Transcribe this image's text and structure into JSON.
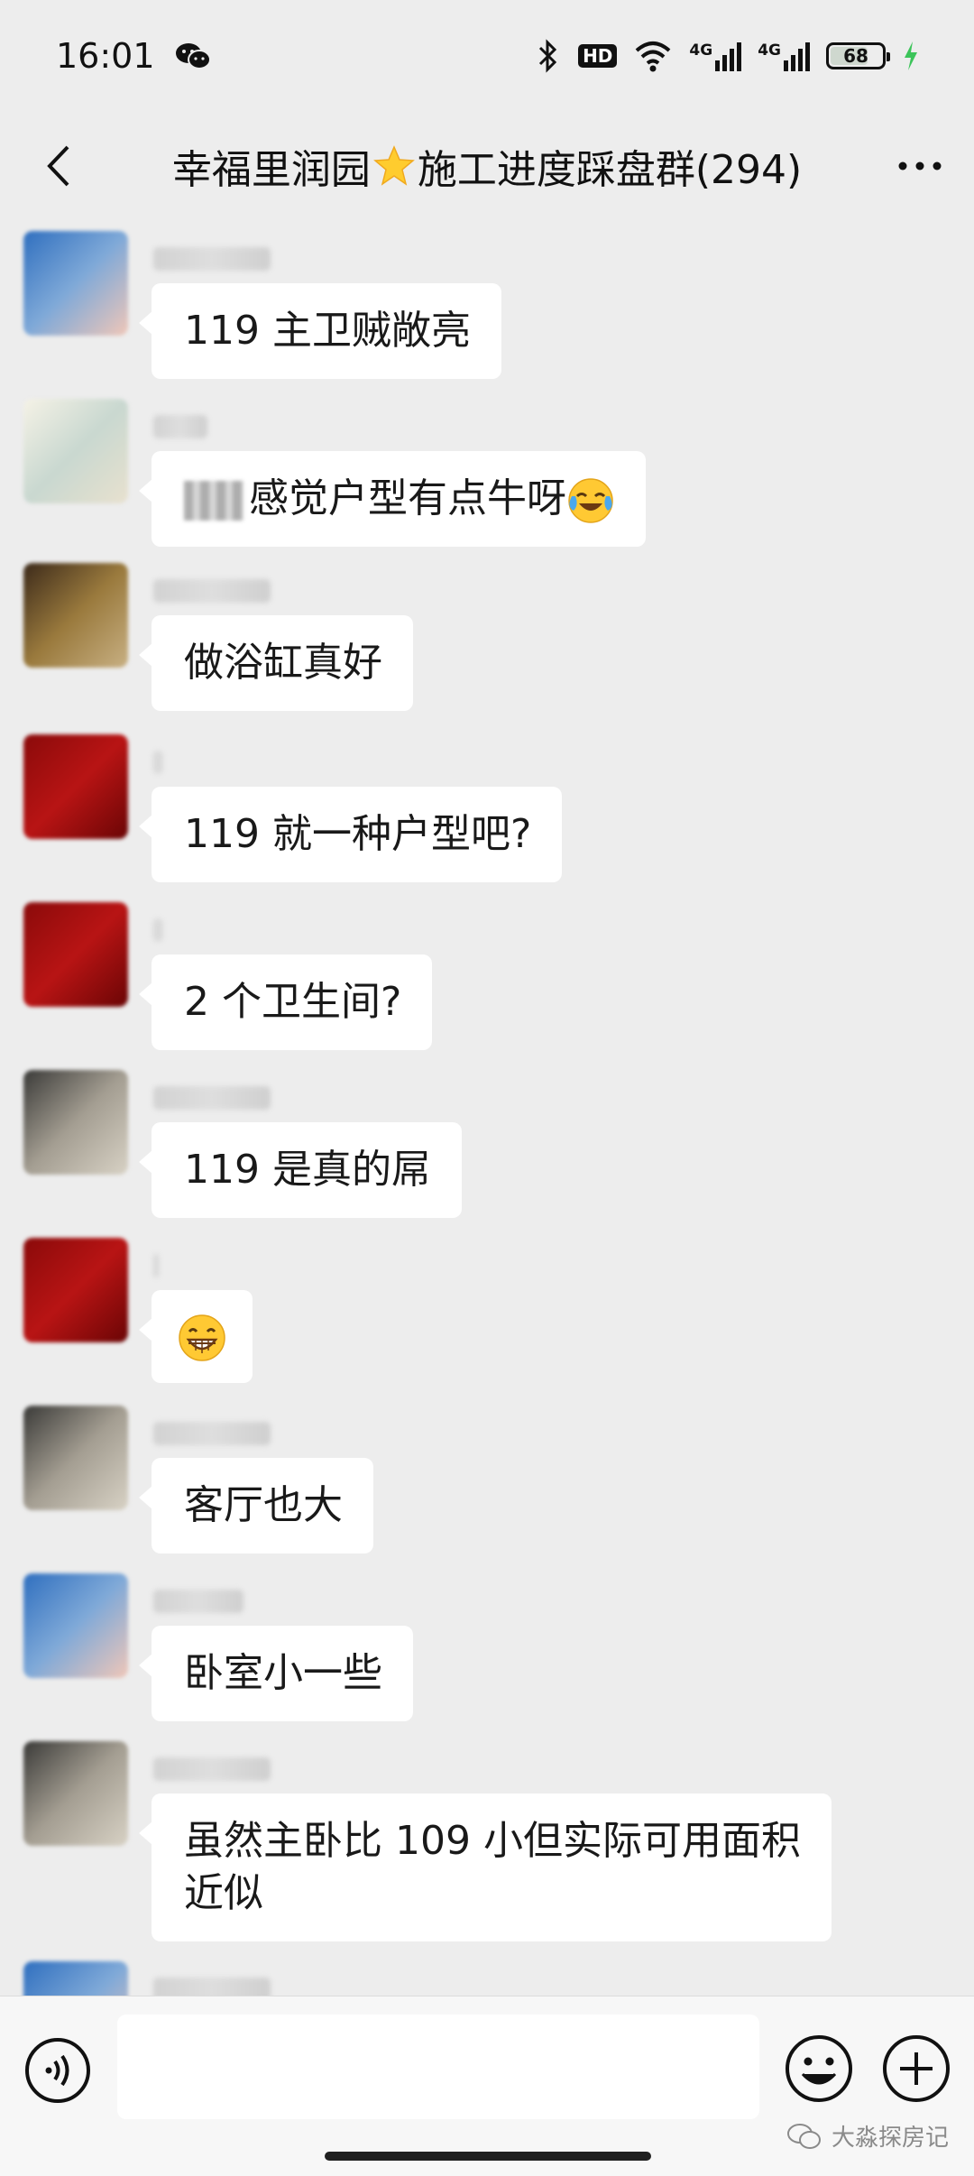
{
  "status_bar": {
    "time": "16:01",
    "hd_label": "HD",
    "net1": "4G",
    "net2": "4G",
    "battery": "68",
    "battery_level": 0.68,
    "icons": [
      "wechat-icon",
      "bluetooth-icon",
      "wifi-icon",
      "signal-icon",
      "charging-icon"
    ]
  },
  "header": {
    "title_part1": "幸福里润园",
    "title_star": "star-emoji",
    "title_part2": "施工进度踩盘群(294)",
    "back_icon": "chevron-left-icon",
    "more_icon": "more-icon"
  },
  "messages": [
    {
      "text": "119 主卫贼敞亮",
      "avatar_colors": [
        "#2f6fbf",
        "#7fa9d8",
        "#f0c7b8"
      ]
    },
    {
      "text": "感觉户型有点牛呀",
      "prefix_censored": true,
      "emoji": "laugh-cry-emoji",
      "avatar_colors": [
        "#f5f2e6",
        "#c9d8d0",
        "#e8e1cf"
      ]
    },
    {
      "text": "做浴缸真好",
      "avatar_colors": [
        "#3c2a1a",
        "#9a7a3d",
        "#c8b083"
      ]
    },
    {
      "text": "119 就一种户型吧?",
      "avatar_colors": [
        "#8a0a0a",
        "#b81414",
        "#6a0505"
      ]
    },
    {
      "text": "2 个卫生间?",
      "avatar_colors": [
        "#8a0a0a",
        "#b81414",
        "#6a0505"
      ]
    },
    {
      "text": "119 是真的屌",
      "avatar_colors": [
        "#3a3a38",
        "#a49e92",
        "#d8d2c5"
      ]
    },
    {
      "text": "",
      "emoji": "grin-emoji",
      "avatar_colors": [
        "#8a0a0a",
        "#b81414",
        "#6a0505"
      ]
    },
    {
      "text": "客厅也大",
      "avatar_colors": [
        "#3a3a38",
        "#a49e92",
        "#d8d2c5"
      ]
    },
    {
      "text": "卧室小一些",
      "avatar_colors": [
        "#2f6fbf",
        "#7fa9d8",
        "#f0c7b8"
      ]
    },
    {
      "text": "虽然主卧比 109 小但实际可用面积\n近似",
      "avatar_colors": [
        "#3a3a38",
        "#a49e92",
        "#d8d2c5"
      ]
    }
  ],
  "input": {
    "placeholder": "",
    "voice_icon": "voice-icon",
    "emoji_icon": "emoji-icon",
    "plus_icon": "plus-icon"
  },
  "watermark": "大淼探房记"
}
